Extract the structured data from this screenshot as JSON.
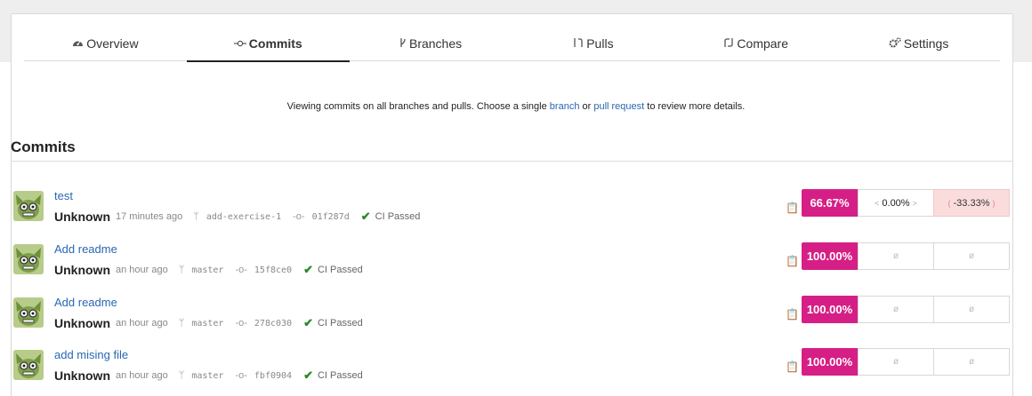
{
  "tabs": [
    {
      "label": "Overview",
      "icon": "dashboard-icon",
      "active": false
    },
    {
      "label": "Commits",
      "icon": "commit-icon",
      "active": true
    },
    {
      "label": "Branches",
      "icon": "branch-icon",
      "active": false
    },
    {
      "label": "Pulls",
      "icon": "pull-request-icon",
      "active": false
    },
    {
      "label": "Compare",
      "icon": "compare-icon",
      "active": false
    },
    {
      "label": "Settings",
      "icon": "gear-icon",
      "active": false
    }
  ],
  "info": {
    "prefix": "Viewing commits on all branches and pulls. Choose a single ",
    "branch_link": "branch",
    "middle": " or ",
    "pull_link": "pull request",
    "suffix": " to review more details."
  },
  "heading": "Commits",
  "commits": [
    {
      "title": "test",
      "author": "Unknown",
      "time": "17 minutes ago",
      "branch": "add-exercise-1",
      "sha": "01f287d",
      "ci": "CI Passed",
      "coverage": "66.67%",
      "diff": "0.00%",
      "change": "-33.33%"
    },
    {
      "title": "Add readme",
      "author": "Unknown",
      "time": "an hour ago",
      "branch": "master",
      "sha": "15f8ce0",
      "ci": "CI Passed",
      "coverage": "100.00%",
      "diff": "ø",
      "change": "ø"
    },
    {
      "title": "Add readme",
      "author": "Unknown",
      "time": "an hour ago",
      "branch": "master",
      "sha": "278c030",
      "ci": "CI Passed",
      "coverage": "100.00%",
      "diff": "ø",
      "change": "ø"
    },
    {
      "title": "add mising file",
      "author": "Unknown",
      "time": "an hour ago",
      "branch": "master",
      "sha": "fbf0904",
      "ci": "CI Passed",
      "coverage": "100.00%",
      "diff": "ø",
      "change": "ø"
    }
  ],
  "colors": {
    "coverage": "#d61f86",
    "link": "#2a67b1",
    "ci_check": "#2a8a2a",
    "negative_bg": "#fbdcdc"
  }
}
